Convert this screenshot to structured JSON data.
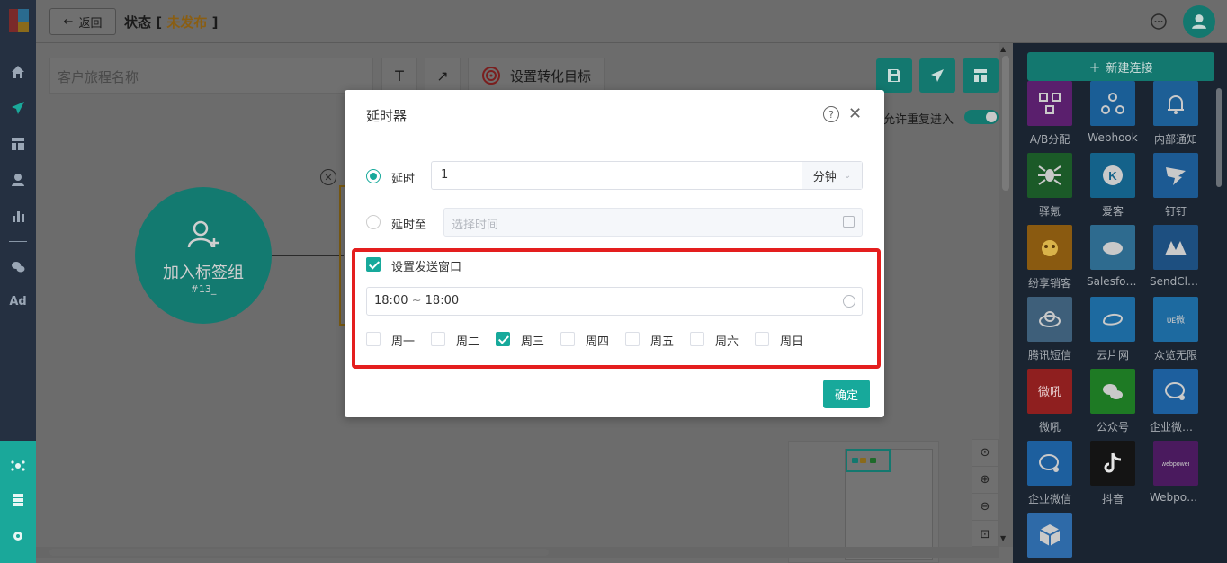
{
  "header": {
    "back_label": "返回",
    "title": "状态",
    "status_open": "[",
    "status": "未发布",
    "status_close": "]"
  },
  "toolbar": {
    "journey_name_placeholder": "客户旅程名称",
    "text_tool": "T",
    "arrow_tool": "↗",
    "goal_label": "设置转化目标",
    "allow_reenter_label": "允许重复进入",
    "allow_reenter_on": true
  },
  "canvas": {
    "node": {
      "label": "加入标签组",
      "sub": "#13_"
    }
  },
  "right_panel": {
    "new_connection_label": "新建连接",
    "connectors": [
      {
        "name": "A/B分配",
        "icon": "ab-split-icon",
        "color": "#5a1f6d"
      },
      {
        "name": "Webhook",
        "icon": "webhook-icon",
        "color": "#1a5e96"
      },
      {
        "name": "内部通知",
        "icon": "bell-icon",
        "color": "#1d5f96"
      },
      {
        "name": "驿氪",
        "icon": "spider-icon",
        "color": "#1b5a28"
      },
      {
        "name": "爱客",
        "icon": "k-icon",
        "color": "#14628a"
      },
      {
        "name": "钉钉",
        "icon": "dingtalk-icon",
        "color": "#1c5a93"
      },
      {
        "name": "纷享销客",
        "icon": "fxiaoke-icon",
        "color": "#8a5a10"
      },
      {
        "name": "Salesforce",
        "icon": "salesforce-cloud-icon",
        "color": "#2e6b8f"
      },
      {
        "name": "SendCloud",
        "icon": "sendcloud-icon",
        "color": "#1d4f80"
      },
      {
        "name": "腾讯短信",
        "icon": "tencent-cloud-icon",
        "color": "#3e5f7a"
      },
      {
        "name": "云片网",
        "icon": "yunpian-icon",
        "color": "#1d6aa0"
      },
      {
        "name": "众览无限",
        "icon": "weiyun-icon",
        "color": "#1d6aa0"
      },
      {
        "name": "微吼",
        "icon": "vhall-icon",
        "color": "#8f1f1f"
      },
      {
        "name": "公众号",
        "icon": "wechat-icon",
        "color": "#1e7a24"
      },
      {
        "name": "企业微信...",
        "icon": "wecom-icon",
        "color": "#1d5f9e"
      },
      {
        "name": "企业微信",
        "icon": "wecom-icon",
        "color": "#1d5f9e"
      },
      {
        "name": "抖音",
        "icon": "douyin-icon",
        "color": "#141414"
      },
      {
        "name": "Webpower",
        "icon": "webpower-icon",
        "color": "#4a1a5e"
      },
      {
        "name": "",
        "icon": "cube-icon",
        "color": "#2e6aa8"
      }
    ]
  },
  "modal": {
    "title": "延时器",
    "delay_label": "延时",
    "delay_value": "1",
    "delay_unit": "分钟",
    "delay_until_label": "延时至",
    "delay_until_placeholder": "选择时间",
    "send_window_label": "设置发送窗口",
    "time_start": "18:00",
    "time_sep": "~",
    "time_end": "18:00",
    "weekdays": [
      {
        "label": "周一",
        "checked": false
      },
      {
        "label": "周二",
        "checked": false
      },
      {
        "label": "周三",
        "checked": true
      },
      {
        "label": "周四",
        "checked": false
      },
      {
        "label": "周五",
        "checked": false
      },
      {
        "label": "周六",
        "checked": false
      },
      {
        "label": "周日",
        "checked": false
      }
    ],
    "confirm_label": "确定"
  },
  "colors": {
    "accent": "#17a99b",
    "highlight_box": "#e41e1e",
    "status": "#c8860f"
  }
}
